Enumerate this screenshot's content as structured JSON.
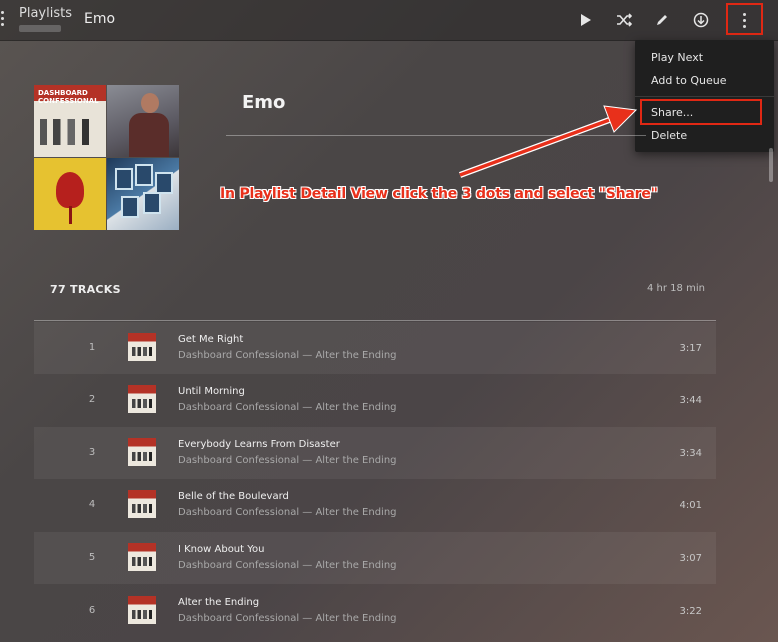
{
  "topbar": {
    "breadcrumb": "Playlists",
    "playlist_title": "Emo"
  },
  "menu": {
    "items": [
      "Play Next",
      "Add to Queue",
      "Share...",
      "Delete"
    ]
  },
  "playlist": {
    "title": "Emo",
    "track_count_label": "77 TRACKS",
    "total_duration": "4 hr 18 min"
  },
  "annotation": {
    "text": "In Playlist Detail View click the 3 dots and select \"Share\"",
    "color": "#e8301b"
  },
  "album_art": {
    "band_text": "DASHBOARD CONFESSIONAL"
  },
  "tracks": [
    {
      "num": "1",
      "title": "Get Me Right",
      "subtitle": "Dashboard Confessional — Alter the Ending",
      "duration": "3:17"
    },
    {
      "num": "2",
      "title": "Until Morning",
      "subtitle": "Dashboard Confessional — Alter the Ending",
      "duration": "3:44"
    },
    {
      "num": "3",
      "title": "Everybody Learns From Disaster",
      "subtitle": "Dashboard Confessional — Alter the Ending",
      "duration": "3:34"
    },
    {
      "num": "4",
      "title": "Belle of the Boulevard",
      "subtitle": "Dashboard Confessional — Alter the Ending",
      "duration": "4:01"
    },
    {
      "num": "5",
      "title": "I Know About You",
      "subtitle": "Dashboard Confessional — Alter the Ending",
      "duration": "3:07"
    },
    {
      "num": "6",
      "title": "Alter the Ending",
      "subtitle": "Dashboard Confessional — Alter the Ending",
      "duration": "3:22"
    }
  ]
}
